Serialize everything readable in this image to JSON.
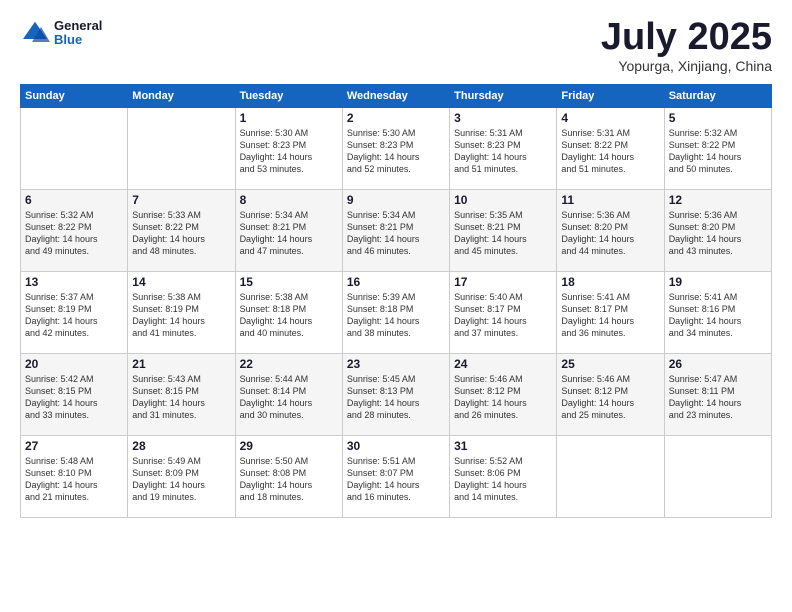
{
  "header": {
    "logo": {
      "general": "General",
      "blue": "Blue"
    },
    "title": "July 2025",
    "location": "Yopurga, Xinjiang, China"
  },
  "weekdays": [
    "Sunday",
    "Monday",
    "Tuesday",
    "Wednesday",
    "Thursday",
    "Friday",
    "Saturday"
  ],
  "weeks": [
    [
      {
        "day": "",
        "info": ""
      },
      {
        "day": "",
        "info": ""
      },
      {
        "day": "1",
        "info": "Sunrise: 5:30 AM\nSunset: 8:23 PM\nDaylight: 14 hours\nand 53 minutes."
      },
      {
        "day": "2",
        "info": "Sunrise: 5:30 AM\nSunset: 8:23 PM\nDaylight: 14 hours\nand 52 minutes."
      },
      {
        "day": "3",
        "info": "Sunrise: 5:31 AM\nSunset: 8:23 PM\nDaylight: 14 hours\nand 51 minutes."
      },
      {
        "day": "4",
        "info": "Sunrise: 5:31 AM\nSunset: 8:22 PM\nDaylight: 14 hours\nand 51 minutes."
      },
      {
        "day": "5",
        "info": "Sunrise: 5:32 AM\nSunset: 8:22 PM\nDaylight: 14 hours\nand 50 minutes."
      }
    ],
    [
      {
        "day": "6",
        "info": "Sunrise: 5:32 AM\nSunset: 8:22 PM\nDaylight: 14 hours\nand 49 minutes."
      },
      {
        "day": "7",
        "info": "Sunrise: 5:33 AM\nSunset: 8:22 PM\nDaylight: 14 hours\nand 48 minutes."
      },
      {
        "day": "8",
        "info": "Sunrise: 5:34 AM\nSunset: 8:21 PM\nDaylight: 14 hours\nand 47 minutes."
      },
      {
        "day": "9",
        "info": "Sunrise: 5:34 AM\nSunset: 8:21 PM\nDaylight: 14 hours\nand 46 minutes."
      },
      {
        "day": "10",
        "info": "Sunrise: 5:35 AM\nSunset: 8:21 PM\nDaylight: 14 hours\nand 45 minutes."
      },
      {
        "day": "11",
        "info": "Sunrise: 5:36 AM\nSunset: 8:20 PM\nDaylight: 14 hours\nand 44 minutes."
      },
      {
        "day": "12",
        "info": "Sunrise: 5:36 AM\nSunset: 8:20 PM\nDaylight: 14 hours\nand 43 minutes."
      }
    ],
    [
      {
        "day": "13",
        "info": "Sunrise: 5:37 AM\nSunset: 8:19 PM\nDaylight: 14 hours\nand 42 minutes."
      },
      {
        "day": "14",
        "info": "Sunrise: 5:38 AM\nSunset: 8:19 PM\nDaylight: 14 hours\nand 41 minutes."
      },
      {
        "day": "15",
        "info": "Sunrise: 5:38 AM\nSunset: 8:18 PM\nDaylight: 14 hours\nand 40 minutes."
      },
      {
        "day": "16",
        "info": "Sunrise: 5:39 AM\nSunset: 8:18 PM\nDaylight: 14 hours\nand 38 minutes."
      },
      {
        "day": "17",
        "info": "Sunrise: 5:40 AM\nSunset: 8:17 PM\nDaylight: 14 hours\nand 37 minutes."
      },
      {
        "day": "18",
        "info": "Sunrise: 5:41 AM\nSunset: 8:17 PM\nDaylight: 14 hours\nand 36 minutes."
      },
      {
        "day": "19",
        "info": "Sunrise: 5:41 AM\nSunset: 8:16 PM\nDaylight: 14 hours\nand 34 minutes."
      }
    ],
    [
      {
        "day": "20",
        "info": "Sunrise: 5:42 AM\nSunset: 8:15 PM\nDaylight: 14 hours\nand 33 minutes."
      },
      {
        "day": "21",
        "info": "Sunrise: 5:43 AM\nSunset: 8:15 PM\nDaylight: 14 hours\nand 31 minutes."
      },
      {
        "day": "22",
        "info": "Sunrise: 5:44 AM\nSunset: 8:14 PM\nDaylight: 14 hours\nand 30 minutes."
      },
      {
        "day": "23",
        "info": "Sunrise: 5:45 AM\nSunset: 8:13 PM\nDaylight: 14 hours\nand 28 minutes."
      },
      {
        "day": "24",
        "info": "Sunrise: 5:46 AM\nSunset: 8:12 PM\nDaylight: 14 hours\nand 26 minutes."
      },
      {
        "day": "25",
        "info": "Sunrise: 5:46 AM\nSunset: 8:12 PM\nDaylight: 14 hours\nand 25 minutes."
      },
      {
        "day": "26",
        "info": "Sunrise: 5:47 AM\nSunset: 8:11 PM\nDaylight: 14 hours\nand 23 minutes."
      }
    ],
    [
      {
        "day": "27",
        "info": "Sunrise: 5:48 AM\nSunset: 8:10 PM\nDaylight: 14 hours\nand 21 minutes."
      },
      {
        "day": "28",
        "info": "Sunrise: 5:49 AM\nSunset: 8:09 PM\nDaylight: 14 hours\nand 19 minutes."
      },
      {
        "day": "29",
        "info": "Sunrise: 5:50 AM\nSunset: 8:08 PM\nDaylight: 14 hours\nand 18 minutes."
      },
      {
        "day": "30",
        "info": "Sunrise: 5:51 AM\nSunset: 8:07 PM\nDaylight: 14 hours\nand 16 minutes."
      },
      {
        "day": "31",
        "info": "Sunrise: 5:52 AM\nSunset: 8:06 PM\nDaylight: 14 hours\nand 14 minutes."
      },
      {
        "day": "",
        "info": ""
      },
      {
        "day": "",
        "info": ""
      }
    ]
  ]
}
